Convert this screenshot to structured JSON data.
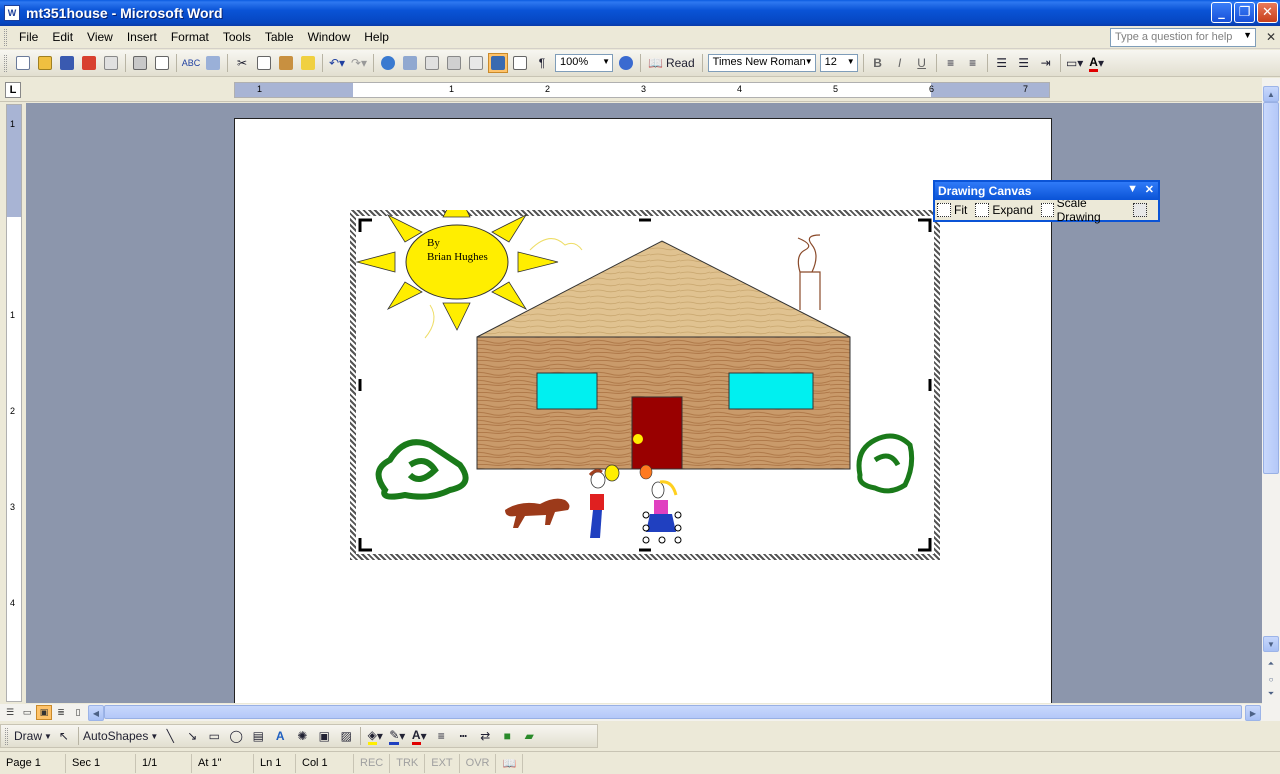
{
  "window": {
    "title": "mt351house - Microsoft Word",
    "icon": "W"
  },
  "menu": {
    "items": [
      "File",
      "Edit",
      "View",
      "Insert",
      "Format",
      "Tools",
      "Table",
      "Window",
      "Help"
    ],
    "help_placeholder": "Type a question for help"
  },
  "toolbar": {
    "zoom": "100%",
    "read_label": "Read",
    "font_name": "Times New Roman",
    "font_size": "12",
    "bold": "B",
    "italic": "I",
    "underline": "U",
    "pilcrow": "¶"
  },
  "ruler": {
    "tab_selector": "L",
    "h_numbers": [
      "1",
      "1",
      "2",
      "3",
      "4",
      "5",
      "6",
      "7"
    ],
    "v_numbers": [
      "1",
      "1",
      "2",
      "3",
      "4"
    ]
  },
  "canvas": {
    "author_line1": "By",
    "author_line2": "Brian Hughes"
  },
  "drawing_canvas_toolbar": {
    "title": "Drawing Canvas",
    "fit": "Fit",
    "expand": "Expand",
    "scale": "Scale Drawing"
  },
  "drawing_toolbar": {
    "draw": "Draw",
    "autoshapes": "AutoShapes"
  },
  "status": {
    "page": "Page 1",
    "sec": "Sec 1",
    "pages": "1/1",
    "at": "At 1\"",
    "ln": "Ln 1",
    "col": "Col 1",
    "rec": "REC",
    "trk": "TRK",
    "ext": "EXT",
    "ovr": "OVR"
  },
  "colors": {
    "title_blue": "#0a53d6",
    "sun": "#ffee00",
    "window_glass": "#00f0f0",
    "door": "#990000",
    "bush": "#1a7a1a",
    "dog": "#9c3a1a"
  }
}
